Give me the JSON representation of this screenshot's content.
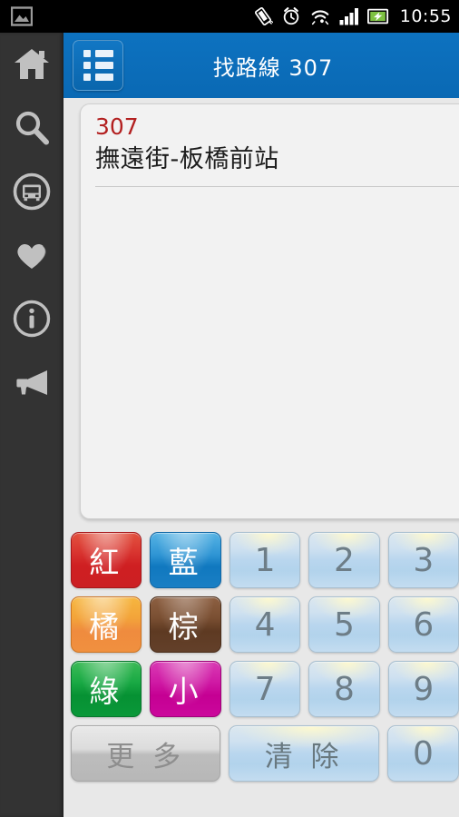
{
  "statusbar": {
    "time": "10:55",
    "icons": [
      "image-icon",
      "screen-rotation-icon",
      "alarm-clock-icon",
      "wifi-icon",
      "signal-bars-icon",
      "battery-charging-icon"
    ]
  },
  "sidebar": {
    "items": [
      {
        "name": "home",
        "label": "首頁",
        "icon": "home-icon"
      },
      {
        "name": "search",
        "label": "搜尋",
        "icon": "search-icon"
      },
      {
        "name": "bus",
        "label": "公車",
        "icon": "bus-icon"
      },
      {
        "name": "favorites",
        "label": "最愛",
        "icon": "heart-icon"
      },
      {
        "name": "info",
        "label": "資訊",
        "icon": "info-icon"
      },
      {
        "name": "announcements",
        "label": "公告",
        "icon": "megaphone-icon"
      }
    ]
  },
  "appbar": {
    "menu_icon": "list-menu-icon",
    "title": "找路線  307"
  },
  "card": {
    "route_number": "307",
    "route_name": "撫遠街-板橋前站"
  },
  "keypad": {
    "rows": [
      [
        {
          "label": "紅",
          "style": "k-red",
          "name": "key-red"
        },
        {
          "label": "藍",
          "style": "k-blue",
          "name": "key-blue"
        },
        {
          "label": "1",
          "style": "k-sky",
          "name": "key-1",
          "num": true
        },
        {
          "label": "2",
          "style": "k-sky",
          "name": "key-2",
          "num": true
        },
        {
          "label": "3",
          "style": "k-sky",
          "name": "key-3",
          "num": true
        }
      ],
      [
        {
          "label": "橘",
          "style": "k-orange",
          "name": "key-orange"
        },
        {
          "label": "棕",
          "style": "k-brown",
          "name": "key-brown"
        },
        {
          "label": "4",
          "style": "k-sky",
          "name": "key-4",
          "num": true
        },
        {
          "label": "5",
          "style": "k-sky",
          "name": "key-5",
          "num": true
        },
        {
          "label": "6",
          "style": "k-sky",
          "name": "key-6",
          "num": true
        }
      ],
      [
        {
          "label": "綠",
          "style": "k-green",
          "name": "key-green"
        },
        {
          "label": "小",
          "style": "k-pink",
          "name": "key-small"
        },
        {
          "label": "7",
          "style": "k-sky",
          "name": "key-7",
          "num": true
        },
        {
          "label": "8",
          "style": "k-sky",
          "name": "key-8",
          "num": true
        },
        {
          "label": "9",
          "style": "k-sky",
          "name": "key-9",
          "num": true
        }
      ],
      [
        {
          "label": "更 多",
          "style": "k-gray",
          "name": "key-more",
          "wide": true
        },
        {
          "label": "清 除",
          "style": "k-sky",
          "name": "key-clear",
          "wide": true
        },
        {
          "label": "0",
          "style": "k-sky",
          "name": "key-0",
          "num": true
        }
      ]
    ]
  },
  "colors": {
    "appbar_blue": "#0a6cb8",
    "sidebar_gray": "#333333",
    "route_red": "#b32020",
    "card_bg": "#f2f2f2",
    "page_bg": "#e8e8e8"
  }
}
